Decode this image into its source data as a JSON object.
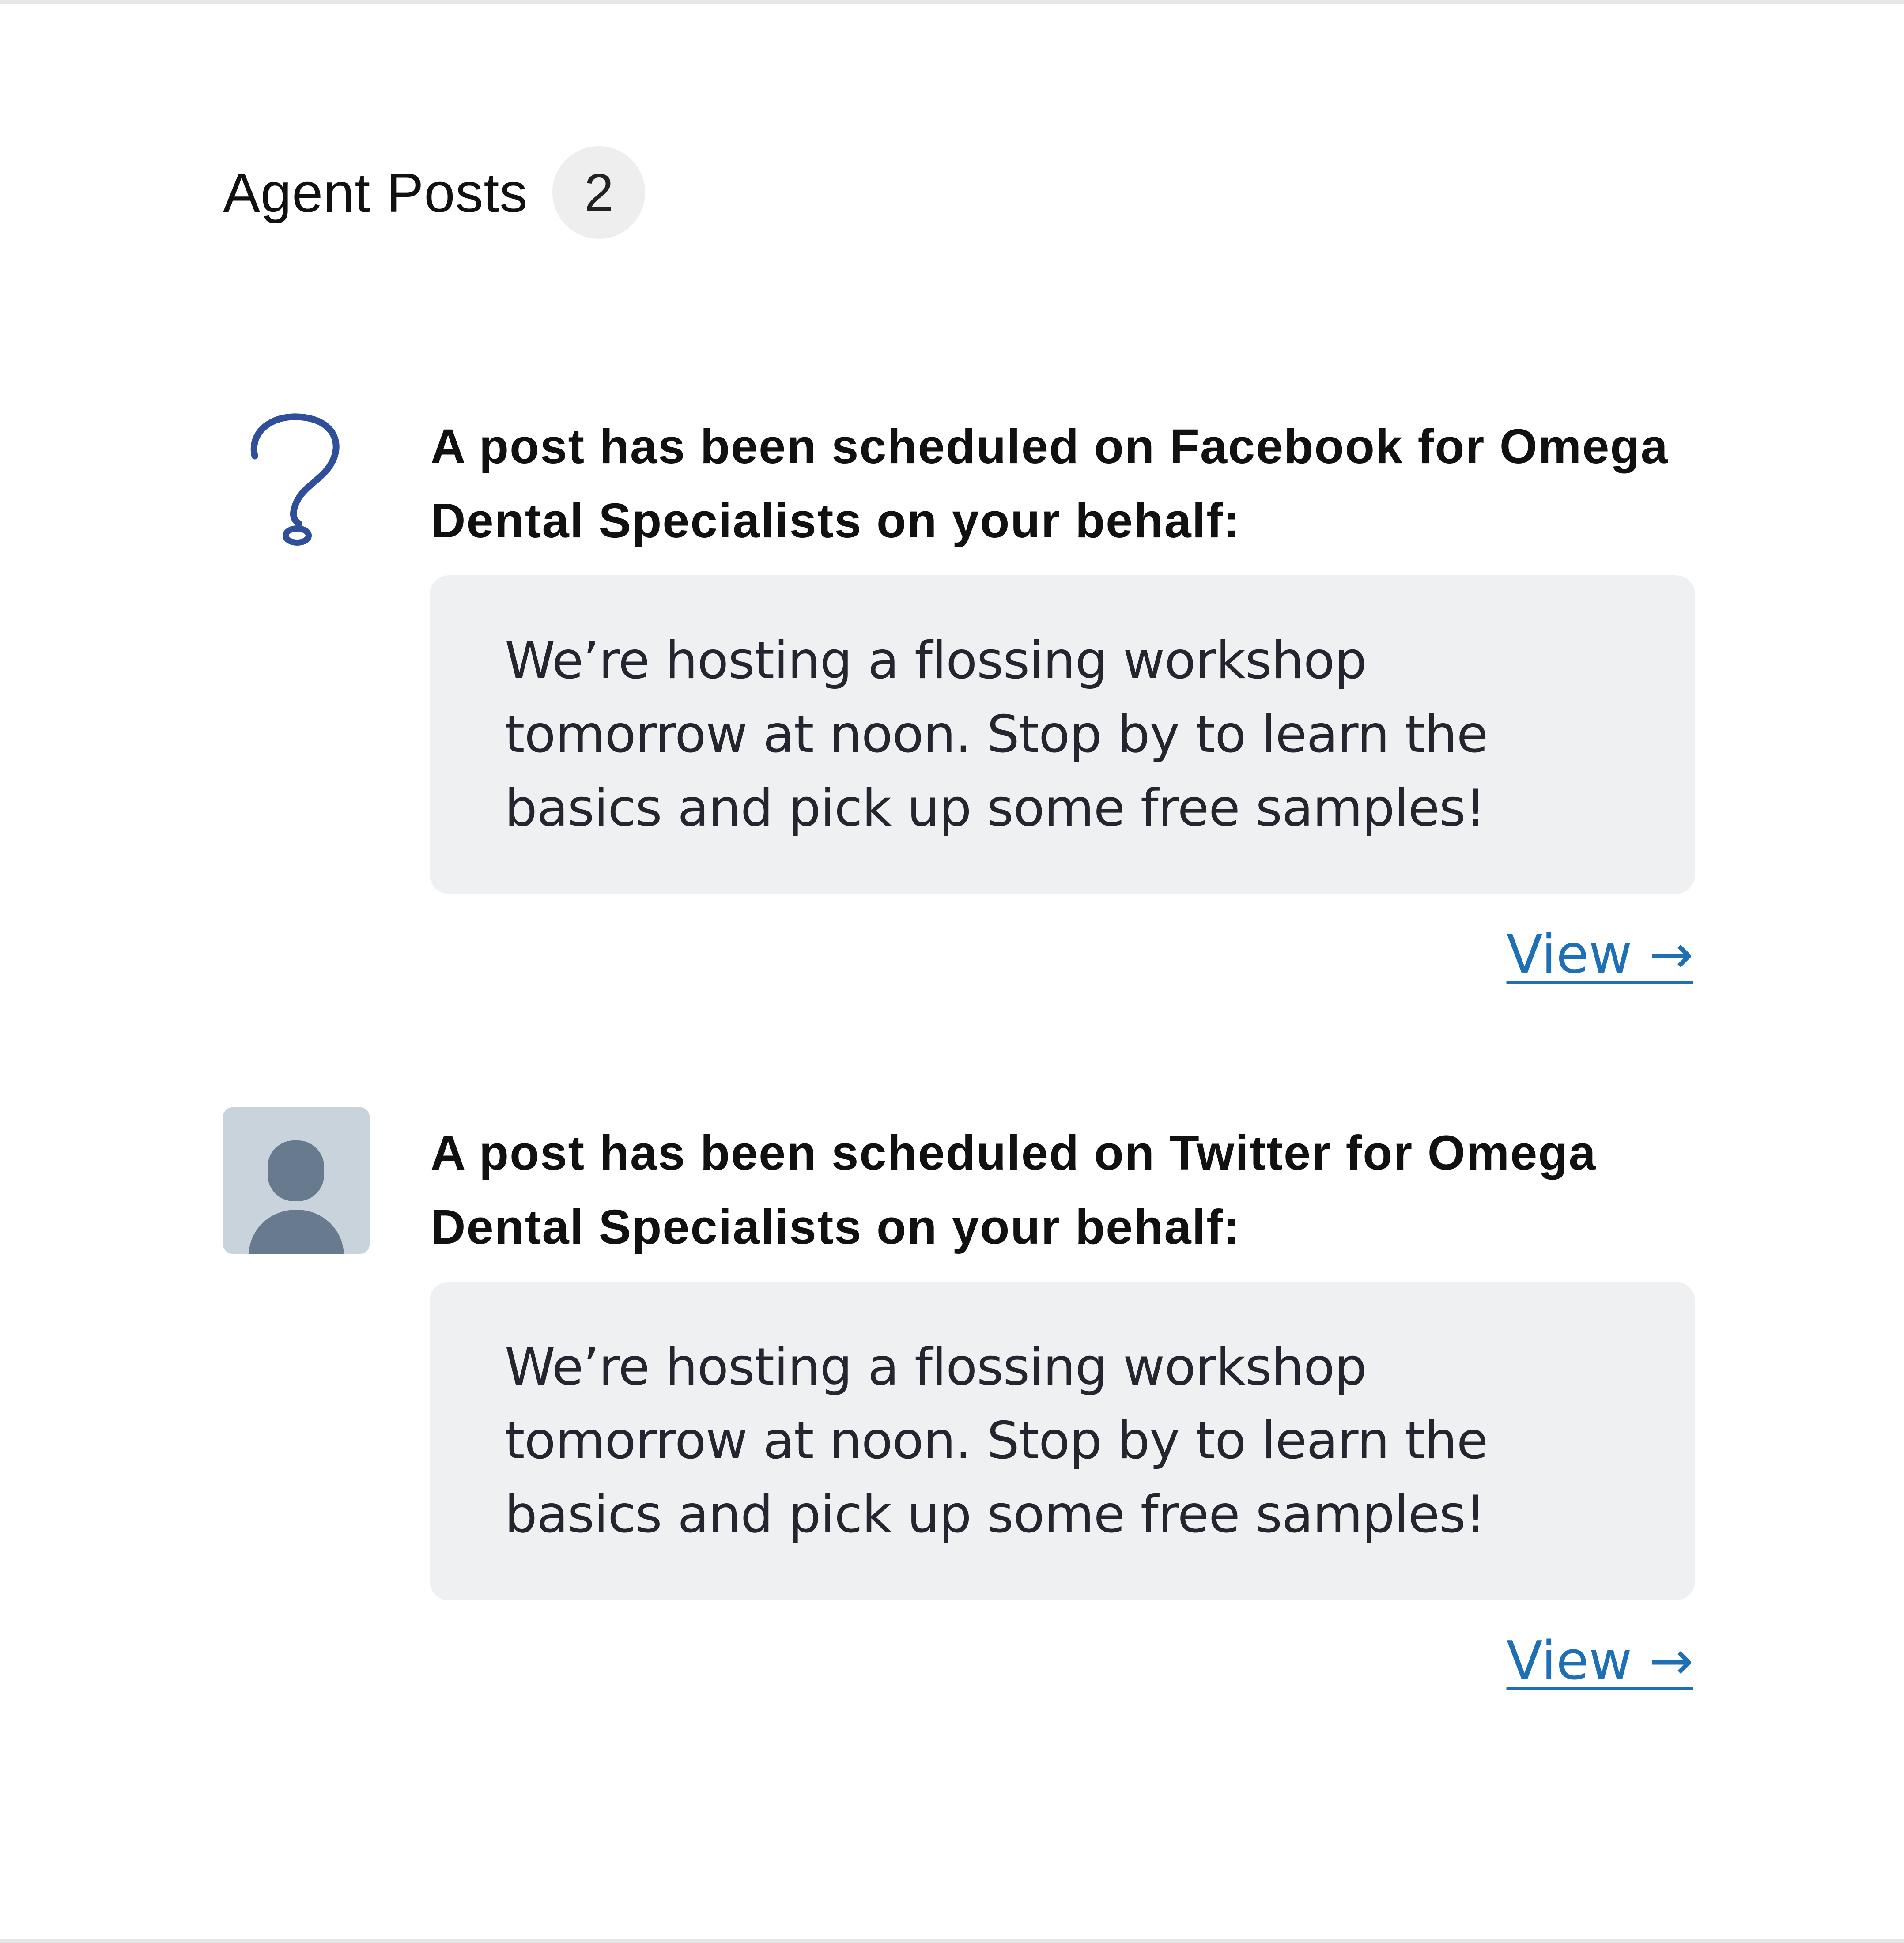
{
  "header": {
    "title": "Agent Posts",
    "count": "2"
  },
  "posts": [
    {
      "title": "A post has been scheduled on Facebook for Omega Dental Specialists on your behalf:",
      "avatar_icon": "question-mark-icon",
      "body_lines": [
        "We’re hosting a flossing workshop",
        "tomorrow at noon. Stop by to learn the",
        "basics and pick up some free samples!"
      ],
      "view_label": "View →"
    },
    {
      "title": "A post has been scheduled on Twitter for Omega Dental Specialists on your behalf:",
      "avatar_icon": "default-person-icon",
      "body_lines": [
        "We’re hosting a flossing workshop",
        "tomorrow at noon. Stop by to learn the",
        "basics and pick up some free samples!"
      ],
      "view_label": "View →"
    }
  ],
  "colors": {
    "link": "#1f6fb4",
    "bubble_background": "#eff0f2",
    "badge_background": "#eeeeee",
    "question_mark": "#2f4f9a",
    "avatar_background": "#c9d3dc",
    "avatar_figure": "#687a8e"
  }
}
